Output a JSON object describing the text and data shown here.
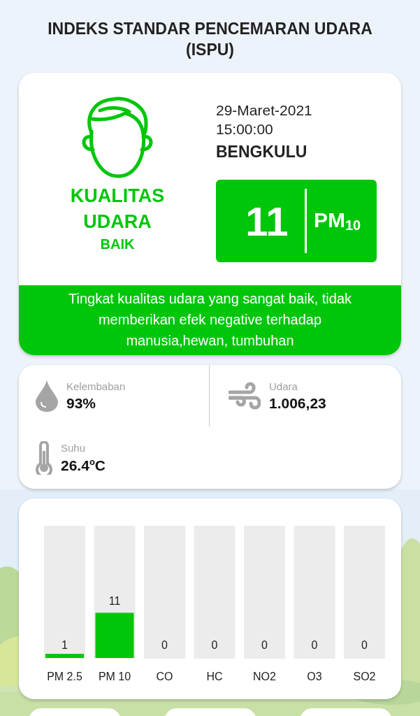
{
  "title": "INDEKS STANDAR PENCEMARAN UDARA (ISPU)",
  "summary": {
    "quality_label": "KUALITAS UDARA",
    "quality": "BAIK",
    "date": "29-Maret-2021",
    "time": "15:00:00",
    "city": "BENGKULU",
    "index_value": "11",
    "pollutant": "PM$_{10}$",
    "description": "Tingkat kualitas udara yang sangat baik, tidak memberikan efek negative terhadap manusia,hewan, tumbuhan"
  },
  "weather": [
    {
      "kind": "humidity",
      "label": "Kelembaban",
      "value": "93%"
    },
    {
      "kind": "wind",
      "label": "Udara",
      "value": "1.006,23"
    },
    {
      "kind": "temperature",
      "label": "Suhu",
      "value": "26.4$^{o}$C"
    }
  ],
  "pollutants": {
    "chart_data": {
      "type": "bar",
      "categories": [
        "PM 2.5",
        "PM 10",
        "CO",
        "HC",
        "NO2",
        "O3",
        "SO2"
      ],
      "values": [
        1,
        11,
        0,
        0,
        0,
        0,
        0
      ],
      "data_labels": true
    }
  }
}
